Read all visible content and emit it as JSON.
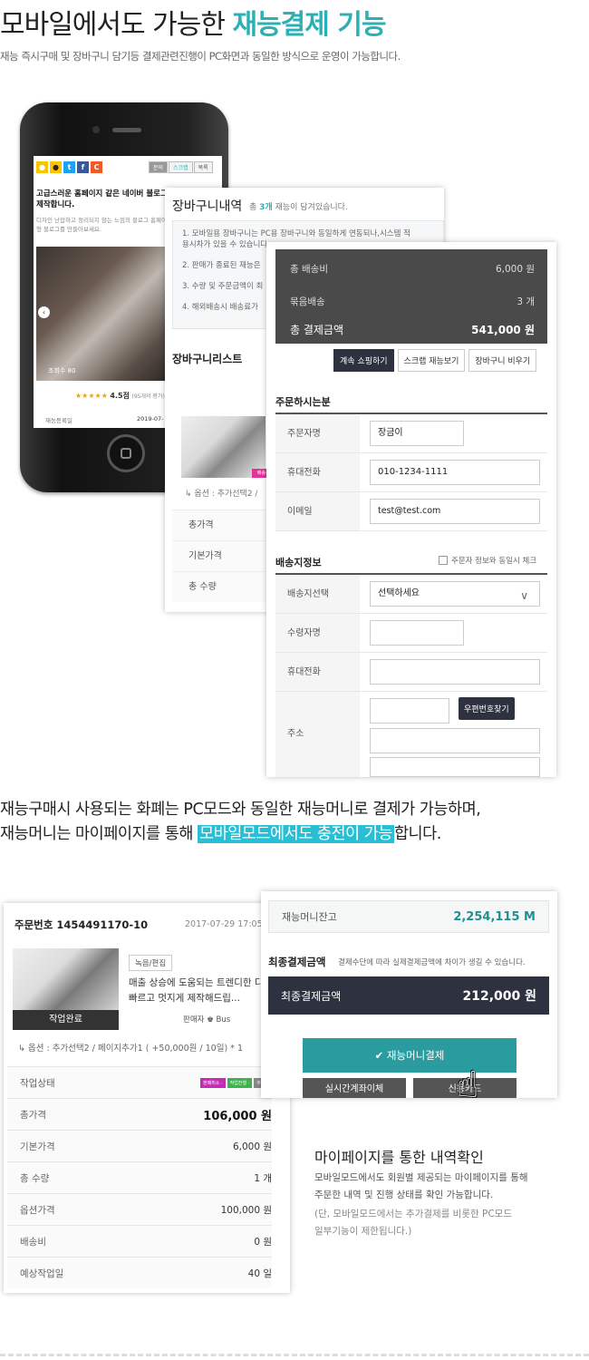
{
  "header": {
    "title_plain": "모바일에서도 가능한 ",
    "title_accent": "재능결제 기능",
    "subtitle": "재능 즉시구매 및 장바구니 담기등 결제관련진행이 PC화면과 동일한 방식으로 운영이 가능합니다."
  },
  "phone": {
    "tab_labels": [
      "문의",
      "스크랩",
      "목록"
    ],
    "post_title": "고급스러운 홈페이지 같은 네이버 블로그 제작합니다.",
    "post_desc": "디자인 난잡하고 정리되지 않는 느낌의 블로그 홈페이지형 블로그를 만들어보세요.",
    "view_count": "조회수 80",
    "rating_label": "4.5점",
    "rating_sub": "(95개의 평가)",
    "registered_label": "재능등록일",
    "registered_date": "2019-07-"
  },
  "cart": {
    "title": "장바구니내역",
    "count_prefix": "총 ",
    "count": "3개",
    "count_suffix": " 재능이 담겨있습니다.",
    "notices": [
      "1. 모바일용 장바구니는 PC용 장바구니와 동일하게 연동되나,시스템 적",
      "용시차가 있을 수 있습니다.",
      "2. 판매가 종료된 재능은",
      "3. 수량 및 주문금액이 최",
      "4. 해외배송시 배송료가"
    ],
    "list_title": "장바구니리스트",
    "badge": "배송상품",
    "option": "옵션 : 추가선택2 /",
    "rows": [
      "총가격",
      "기본가격",
      "총 수량"
    ]
  },
  "order": {
    "summary": [
      {
        "label": "총 배송비",
        "value": "6,000 원"
      },
      {
        "label": "묶음배송",
        "value": "3 개"
      },
      {
        "label": "총 결제금액",
        "value": "541,000 원"
      }
    ],
    "buttons": [
      "계속 쇼핑하기",
      "스크랩 재능보기",
      "장바구니 비우기"
    ],
    "orderer_title": "주문하시는분",
    "orderer_fields": [
      {
        "label": "주문자명",
        "value": "장금이"
      },
      {
        "label": "휴대전화",
        "value": "010-1234-1111"
      },
      {
        "label": "이메일",
        "value": "test@test.com"
      }
    ],
    "shipping_title": "배송지정보",
    "same_as_orderer": "주문자 정보와 동일시 체크",
    "shipping_fields": [
      {
        "label": "배송지선택",
        "value": "선택하세요"
      },
      {
        "label": "수령자명",
        "value": ""
      },
      {
        "label": "휴대전화",
        "value": ""
      },
      {
        "label": "주소",
        "value": ""
      }
    ],
    "postcode_button": "우편번호찾기"
  },
  "middle": {
    "line1": "재능구매시 사용되는 화폐는 PC모드와 동일한 재능머니로 결제가 가능하며,",
    "line2_pre": "재능머니는 마이페이지를 통해 ",
    "line2_highlight": "모바일모드에서도 충전이 가능",
    "line2_post": "합니다."
  },
  "order_card": {
    "order_no": "주문번호 1454491170-10",
    "date": "2017-07-29 17:05",
    "status_overlay": "작업완료",
    "category": "녹음/편집",
    "desc": "매출 상승에 도움되는 트렌디한 디자인 빠르고 멋지게 제작해드립...",
    "seller": "판매자  ♚ Bus",
    "option": "옵션 : 추가선택2 / 페이지추가1 ( +50,000원 / 10일) * 1",
    "status_label": "작업상태",
    "status_chips": [
      "판매취소 ·",
      "작업진행 ·",
      "추가결"
    ],
    "rows": [
      {
        "label": "총가격",
        "value": "106,000 원"
      },
      {
        "label": "기본가격",
        "value": "6,000 원"
      },
      {
        "label": "총 수량",
        "value": "1 개"
      },
      {
        "label": "옵션가격",
        "value": "100,000 원"
      },
      {
        "label": "배송비",
        "value": "0 원"
      },
      {
        "label": "예상작업일",
        "value": "40 일"
      }
    ]
  },
  "money": {
    "balance_label": "재능머니잔고",
    "balance_value": "2,254,115 M",
    "final_title": "최종결제금액",
    "final_note": "결제수단에 따라 실제결제금액에 차이가 생길 수 있습니다.",
    "total_label": "최종결제금액",
    "total_value": "212,000 원",
    "pay_button": "✔ 재능머니결제",
    "btn_realtime": "실시간계좌이체",
    "btn_card": "신용카드"
  },
  "mypage": {
    "title": "마이페이지를 통한 내역확인",
    "line1": "모바일모드에서도 회원별 제공되는 마이페이지를 통해",
    "line2": "주문한 내역 및 진행 상태를 확인 가능합니다.",
    "line3": "(단, 모바일모드에서는 추가결제를 비롯한 PC모드",
    "line4": "일부기능이 제한됩니다.)"
  },
  "colors": {
    "accent": "#2bb0b5",
    "highlight": "#28bed4",
    "dark": "#2d3140",
    "pay": "#2a9c9f"
  }
}
